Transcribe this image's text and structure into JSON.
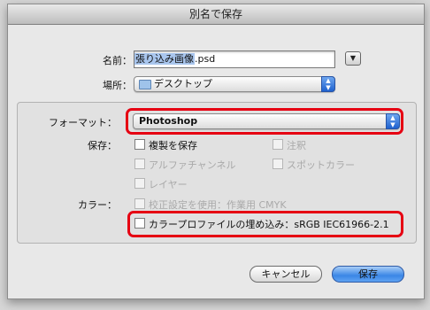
{
  "window": {
    "title": "別名で保存"
  },
  "save_as": {
    "name_label": "名前：",
    "name_value_selected": "張り込み画像",
    "name_value_ext": ".psd",
    "where_label": "場所：",
    "where_value": "デスクトップ"
  },
  "format": {
    "label": "フォーマット：",
    "value": "Photoshop"
  },
  "save_options": {
    "label": "保存：",
    "as_copy": "複製を保存",
    "notes": "注釈",
    "alpha_channels": "アルファチャンネル",
    "spot_colors": "スポットカラー",
    "layers": "レイヤー"
  },
  "color": {
    "label": "カラー：",
    "use_proof": "校正設定を使用：作業用 CMYK",
    "embed_profile": "カラープロファイルの埋め込み：sRGB IEC61966-2.1"
  },
  "buttons": {
    "cancel": "キャンセル",
    "save": "保存"
  },
  "icons": {
    "disclosure": "disclosure-triangle-icon",
    "folder": "folder-icon",
    "popup": "popup-arrows-icon"
  },
  "colors": {
    "highlight_red": "#e60012",
    "primary_button": "#3a86e6",
    "selection": "#a9c6ee"
  }
}
